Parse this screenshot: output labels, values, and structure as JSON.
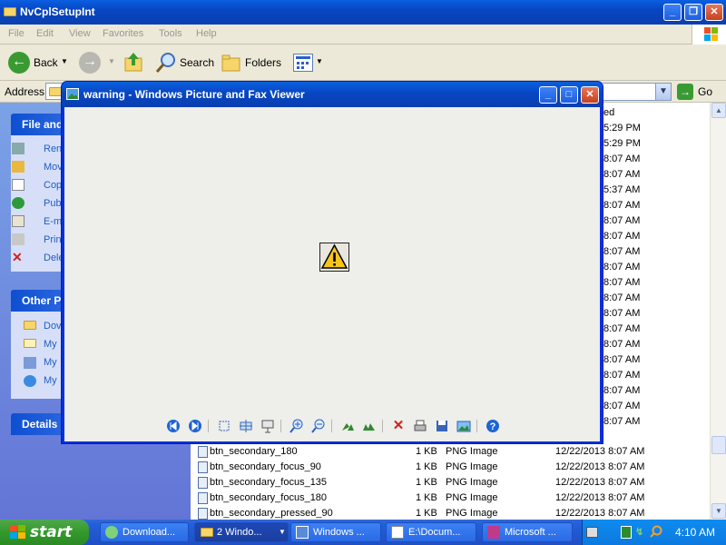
{
  "explorer": {
    "title": "NvCplSetupInt",
    "menu": [
      "File",
      "Edit",
      "View",
      "Favorites",
      "Tools",
      "Help"
    ],
    "toolbar": {
      "back_label": "Back",
      "search_label": "Search",
      "folders_label": "Folders"
    },
    "address": {
      "label": "Address",
      "go_label": "Go"
    },
    "column_modified_fragment": "ed",
    "modified_fragments": [
      "5:29 PM",
      "5:29 PM",
      "8:07 AM",
      "8:07 AM",
      "5:37 AM",
      "8:07 AM",
      "8:07 AM",
      "8:07 AM",
      "8:07 AM",
      "8:07 AM",
      "8:07 AM",
      "8:07 AM",
      "8:07 AM",
      "8:07 AM",
      "8:07 AM",
      "8:07 AM",
      "8:07 AM",
      "8:07 AM",
      "8:07 AM",
      "8:07 AM"
    ],
    "files": [
      {
        "name": "btn_secondary_180",
        "size": "1 KB",
        "type": "PNG Image",
        "date": "12/22/2013 8:07 AM"
      },
      {
        "name": "btn_secondary_focus_90",
        "size": "1 KB",
        "type": "PNG Image",
        "date": "12/22/2013 8:07 AM"
      },
      {
        "name": "btn_secondary_focus_135",
        "size": "1 KB",
        "type": "PNG Image",
        "date": "12/22/2013 8:07 AM"
      },
      {
        "name": "btn_secondary_focus_180",
        "size": "1 KB",
        "type": "PNG Image",
        "date": "12/22/2013 8:07 AM"
      },
      {
        "name": "btn_secondary_pressed_90",
        "size": "1 KB",
        "type": "PNG Image",
        "date": "12/22/2013 8:07 AM"
      }
    ]
  },
  "taskpane": {
    "file_tasks_header": "File and",
    "file_tasks": [
      "Ren",
      "Mov",
      "Cop",
      "Pub",
      "E-m",
      "Prin",
      "Dele"
    ],
    "other_places_header": "Other P",
    "other_places": [
      "Dov",
      "My",
      "My",
      "My"
    ],
    "details_header": "Details"
  },
  "viewer": {
    "title": "warning - Windows Picture and Fax Viewer"
  },
  "taskbar": {
    "start_label": "start",
    "items": [
      {
        "label": "Download..."
      },
      {
        "label": "2 Windo..."
      },
      {
        "label": "Windows ..."
      },
      {
        "label": "E:\\Docum..."
      },
      {
        "label": "Microsoft ..."
      }
    ],
    "clock": "4:10 AM"
  },
  "colors": {
    "xp_blue": "#0a5fe0",
    "start_green": "#339a2b",
    "link_blue": "#215dc6"
  }
}
